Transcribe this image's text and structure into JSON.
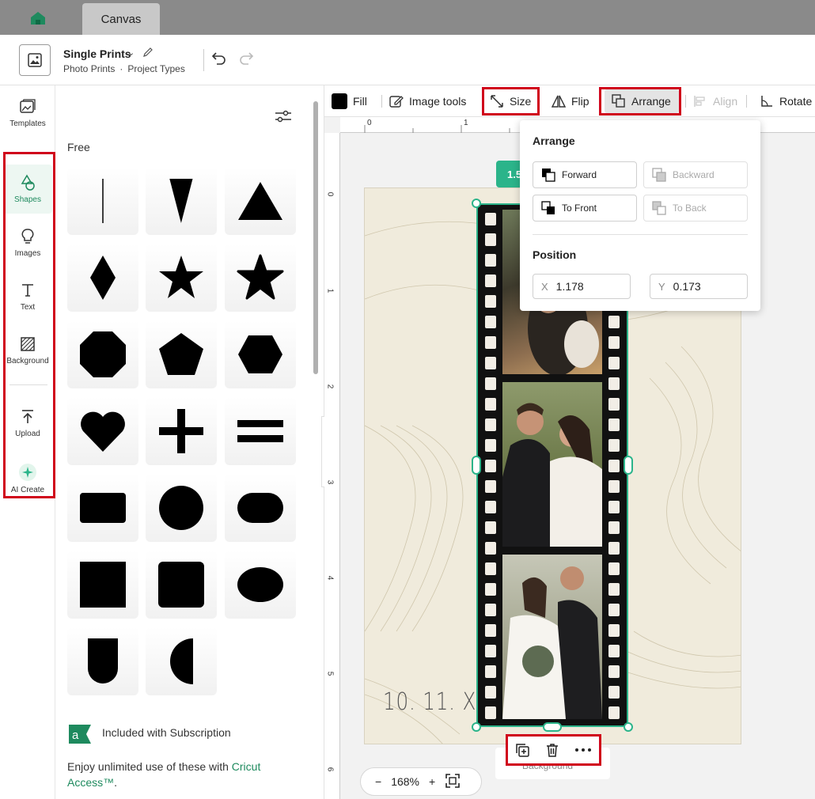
{
  "tabs": {
    "canvas_label": "Canvas"
  },
  "header": {
    "project_title": "Single Prints",
    "breadcrumb": [
      "Photo Prints",
      "·",
      "Project Types"
    ]
  },
  "rail": {
    "items": [
      {
        "label": "Templates",
        "icon": "templates-icon"
      },
      {
        "label": "Shapes",
        "icon": "shapes-icon"
      },
      {
        "label": "Images",
        "icon": "lightbulb-icon"
      },
      {
        "label": "Text",
        "icon": "text-icon"
      },
      {
        "label": "Background",
        "icon": "background-icon"
      },
      {
        "label": "Upload",
        "icon": "upload-icon"
      },
      {
        "label": "AI Create",
        "icon": "sparkle-icon"
      }
    ]
  },
  "shapes_panel": {
    "section_label": "Free",
    "subscription_label": "Included with Subscription",
    "desc_prefix": "Enjoy unlimited use of these with ",
    "desc_link": "Cricut Access™",
    "desc_suffix": "."
  },
  "toolbar": {
    "fill_label": "Fill",
    "image_tools_label": "Image tools",
    "size_label": "Size",
    "flip_label": "Flip",
    "arrange_label": "Arrange",
    "align_label": "Align",
    "rotate_label": "Rotate"
  },
  "rulers": {
    "top": [
      "0",
      "1"
    ],
    "left": [
      "0",
      "1",
      "2",
      "3",
      "4",
      "5",
      "6"
    ]
  },
  "canvas": {
    "date_text": "10. 11. XX",
    "dim_badge": "1.5",
    "layer_label": "Background"
  },
  "zoom": {
    "level": "168%"
  },
  "arrange_popover": {
    "arrange_heading": "Arrange",
    "forward": "Forward",
    "backward": "Backward",
    "to_front": "To Front",
    "to_back": "To Back",
    "position_heading": "Position",
    "x_axis": "X",
    "x_value": "1.178",
    "y_axis": "Y",
    "y_value": "0.173"
  },
  "colors": {
    "accent": "#2bb48a",
    "highlight": "#d0021b",
    "link": "#1e8a5e"
  }
}
